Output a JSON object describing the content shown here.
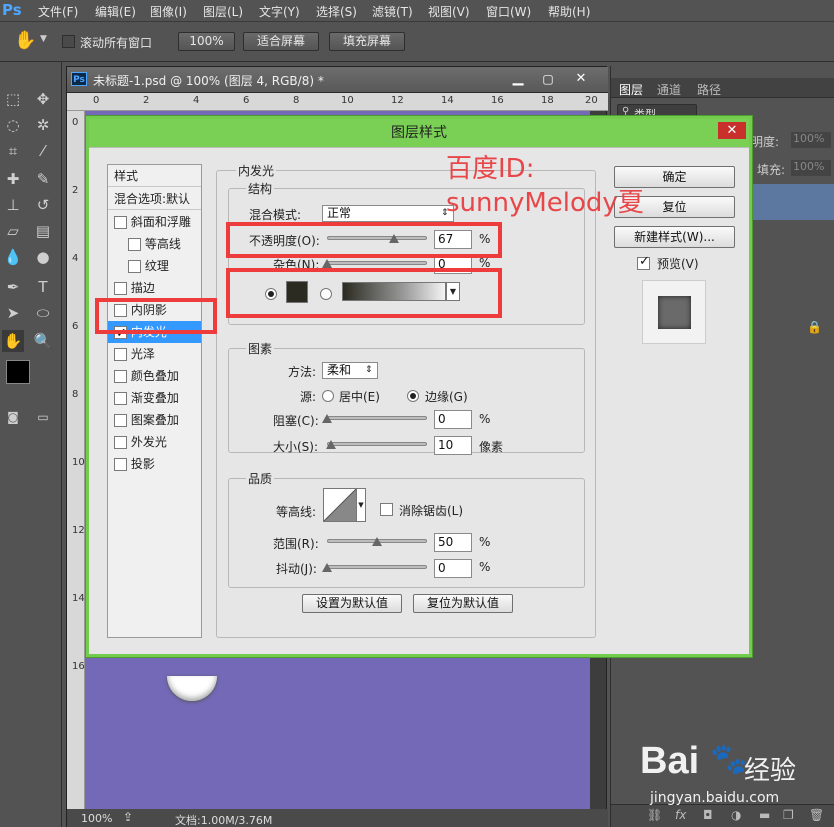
{
  "app": {
    "logo": "Ps"
  },
  "menu": [
    "文件(F)",
    "编辑(E)",
    "图像(I)",
    "图层(L)",
    "文字(Y)",
    "选择(S)",
    "滤镜(T)",
    "视图(V)",
    "窗口(W)",
    "帮助(H)"
  ],
  "options": {
    "scroll_all_label": "滚动所有窗口",
    "zoom_btn": "100%",
    "fit_screen_btn": "适合屏幕",
    "fill_screen_btn": "填充屏幕"
  },
  "document": {
    "tab_title": "未标题-1.psd @ 100% (图层 4, RGB/8) *",
    "ruler_h": [
      "0",
      "2",
      "4",
      "6",
      "8",
      "10",
      "12",
      "14",
      "16",
      "18",
      "20",
      "22"
    ],
    "ruler_v": [
      "0",
      "2",
      "4",
      "6",
      "8",
      "10",
      "12",
      "14",
      "16"
    ],
    "status_zoom": "100%",
    "status_doc": "文档:1.00M/3.76M",
    "canvas_color": "#7369b6"
  },
  "panels": {
    "tabs": [
      "图层",
      "通道",
      "路径"
    ],
    "kind_label": "类型",
    "opacity_label": "明度:",
    "opacity_value": "100%",
    "fill_label": "填充:",
    "fill_value": "100%"
  },
  "dialog": {
    "title": "图层样式",
    "close": "✕",
    "style_list": {
      "header": "样式",
      "blend_default": "混合选项:默认",
      "items": [
        {
          "label": "斜面和浮雕",
          "checked": false,
          "indent": false
        },
        {
          "label": "等高线",
          "checked": false,
          "indent": true
        },
        {
          "label": "纹理",
          "checked": false,
          "indent": true
        },
        {
          "label": "描边",
          "checked": false,
          "indent": false
        },
        {
          "label": "内阴影",
          "checked": false,
          "indent": false
        },
        {
          "label": "内发光",
          "checked": true,
          "indent": false,
          "selected": true
        },
        {
          "label": "光泽",
          "checked": false,
          "indent": false
        },
        {
          "label": "颜色叠加",
          "checked": false,
          "indent": false
        },
        {
          "label": "渐变叠加",
          "checked": false,
          "indent": false
        },
        {
          "label": "图案叠加",
          "checked": false,
          "indent": false
        },
        {
          "label": "外发光",
          "checked": false,
          "indent": false
        },
        {
          "label": "投影",
          "checked": false,
          "indent": false
        }
      ]
    },
    "inner_glow": {
      "section_title": "内发光",
      "structure": {
        "title": "结构",
        "blend_mode_label": "混合模式:",
        "blend_mode_value": "正常",
        "opacity_label": "不透明度(O):",
        "opacity_value": "67",
        "opacity_fraction": 0.67,
        "noise_label": "杂色(N):",
        "noise_value": "0",
        "noise_fraction": 0,
        "unit_percent": "%",
        "color_swatch": "#2b2b22"
      },
      "elements": {
        "title": "图素",
        "method_label": "方法:",
        "method_value": "柔和",
        "source_label": "源:",
        "source_center": "居中(E)",
        "source_edge": "边缘(G)",
        "choke_label": "阻塞(C):",
        "choke_value": "0",
        "choke_fraction": 0,
        "size_label": "大小(S):",
        "size_value": "10",
        "size_fraction": 0.04,
        "unit_px": "像素"
      },
      "quality": {
        "title": "品质",
        "contour_label": "等高线:",
        "antialias_label": "消除锯齿(L)",
        "range_label": "范围(R):",
        "range_value": "50",
        "range_fraction": 0.5,
        "jitter_label": "抖动(J):",
        "jitter_value": "0",
        "jitter_fraction": 0
      },
      "make_default_btn": "设置为默认值",
      "reset_default_btn": "复位为默认值"
    },
    "buttons": {
      "ok": "确定",
      "reset": "复位",
      "new_style": "新建样式(W)...",
      "preview_label": "预览(V)"
    },
    "annotation": {
      "line1": "百度ID:",
      "line2": "sunnyMelody夏"
    }
  },
  "watermark": {
    "brand": "Bai",
    "brand2": "经验",
    "url": "jingyan.baidu.com"
  }
}
